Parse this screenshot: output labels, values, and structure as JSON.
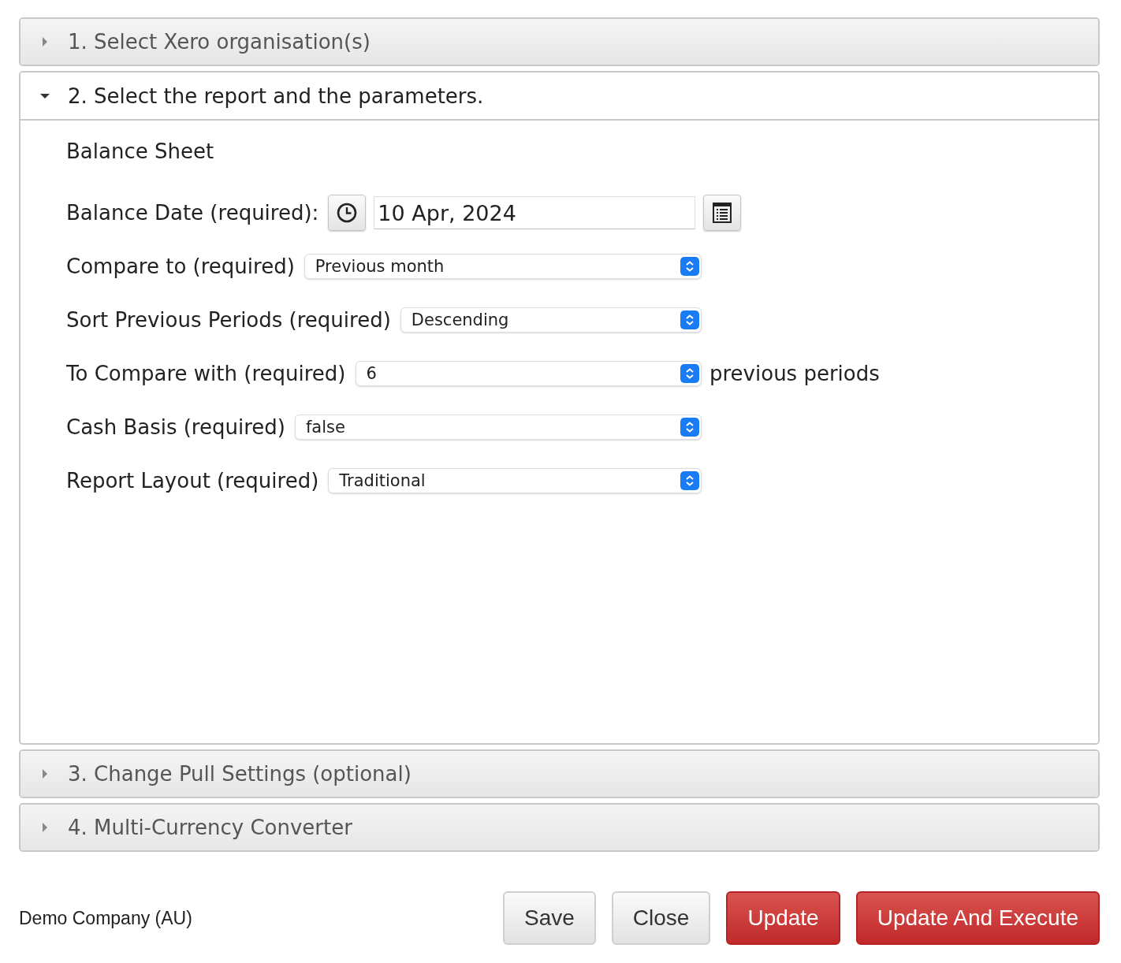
{
  "sections": [
    {
      "title": "1. Select Xero organisation(s)",
      "expanded": false
    },
    {
      "title": "2. Select the report and the parameters.",
      "expanded": true,
      "report_name": "Balance Sheet",
      "fields": [
        {
          "kind": "date",
          "label": "Balance Date (required):",
          "value": "10 Apr, 2024"
        },
        {
          "kind": "select",
          "label": "Compare to (required)",
          "value": "Previous month"
        },
        {
          "kind": "select",
          "label": "Sort Previous Periods (required)",
          "value": "Descending"
        },
        {
          "kind": "select",
          "label": "To Compare with (required)",
          "value": "6",
          "suffix": "previous periods"
        },
        {
          "kind": "select",
          "label": "Cash Basis (required)",
          "value": "false"
        },
        {
          "kind": "select",
          "label": "Report Layout (required)",
          "value": "Traditional"
        }
      ]
    },
    {
      "title": "3. Change Pull Settings (optional)",
      "expanded": false
    },
    {
      "title": "4. Multi-Currency Converter",
      "expanded": false
    }
  ],
  "footer": {
    "company": "Demo Company (AU)",
    "buttons": [
      {
        "label": "Save",
        "kind": "default"
      },
      {
        "label": "Close",
        "kind": "default"
      },
      {
        "label": "Update",
        "kind": "primary"
      },
      {
        "label": "Update And Execute",
        "kind": "primary"
      }
    ]
  }
}
